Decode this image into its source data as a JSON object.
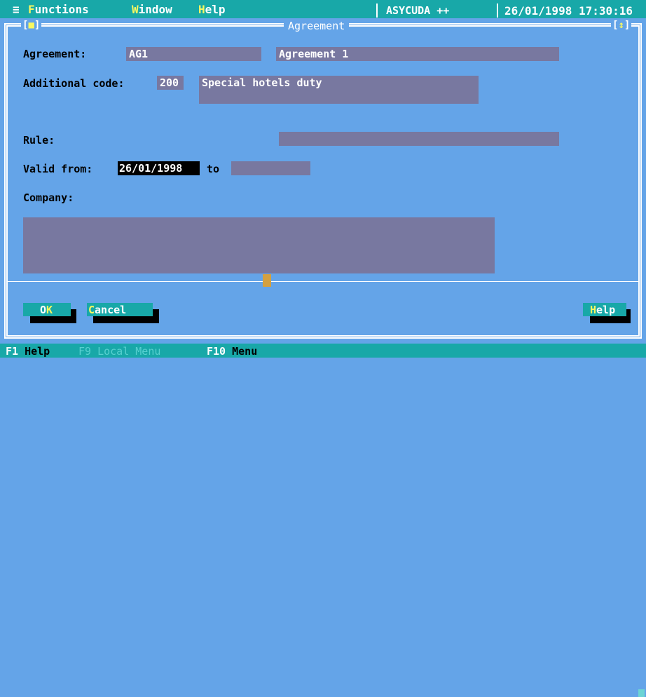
{
  "menubar": {
    "system_icon": "≡",
    "items": [
      {
        "hotkey": "F",
        "rest": "unctions"
      },
      {
        "hotkey": "W",
        "rest": "indow"
      },
      {
        "hotkey": "H",
        "rest": "elp"
      }
    ],
    "app_name": "ASYCUDA ++",
    "datetime": "26/01/1998 17:30:16"
  },
  "window": {
    "title": "Agreement",
    "close_button": "■",
    "resize_button": "↕"
  },
  "form": {
    "agreement_label": "Agreement:",
    "agreement_code": "AG1",
    "agreement_name": "Agreement 1",
    "additional_code_label": "Additional code:",
    "additional_code": "200",
    "additional_code_desc": "Special hotels duty",
    "rule_label": "Rule:",
    "rule_value": "",
    "valid_from_label": "Valid from:",
    "valid_from": "26/01/1998",
    "to_label": "to",
    "valid_to": "",
    "company_label": "Company:",
    "company_value": ""
  },
  "buttons": {
    "ok": {
      "before": "O",
      "hotkey": "K",
      "after": ""
    },
    "cancel": {
      "before": "",
      "hotkey": "C",
      "after": "ancel"
    },
    "help": {
      "before": "",
      "hotkey": "H",
      "after": "elp"
    }
  },
  "statusbar": [
    {
      "key": "F1",
      "text": "Help",
      "enabled": true
    },
    {
      "key": "F9",
      "text": "Local Menu",
      "enabled": false
    },
    {
      "key": "F10",
      "text": "Menu",
      "enabled": true
    }
  ],
  "colors": {
    "background": "#64a4e8",
    "bar": "#18a8a8",
    "field": "#7878a0",
    "hotkey": "#f8f860",
    "thumb": "#d4a040"
  }
}
